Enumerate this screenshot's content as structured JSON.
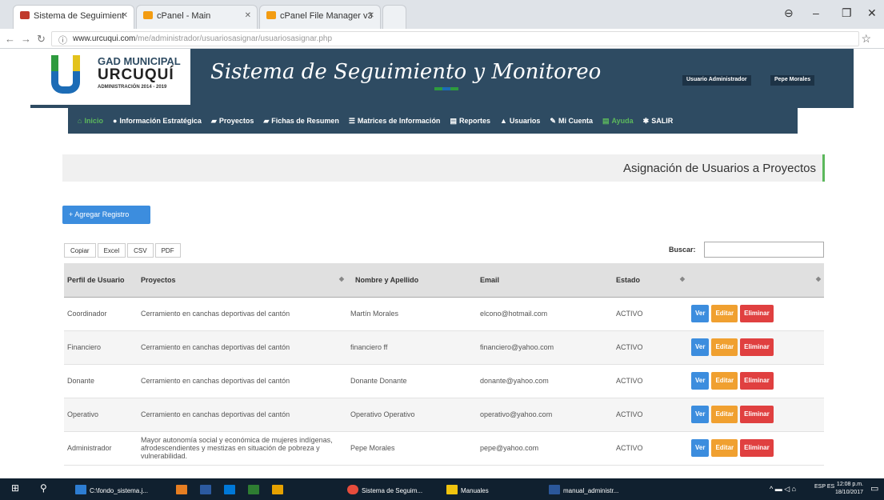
{
  "browser": {
    "tabs": [
      {
        "label": "Sistema de Seguimient",
        "favicon_color": "#c0392b"
      },
      {
        "label": "cPanel - Main",
        "favicon_color": "#f39c12"
      },
      {
        "label": "cPanel File Manager v3",
        "favicon_color": "#f39c12"
      }
    ],
    "url_host": "www.urcuqui.com",
    "url_path": "/me/administrador/usuariosasignar/usuariosasignar.php",
    "back_icon": "back-arrow-icon",
    "forward_icon": "forward-arrow-icon",
    "reload_icon": "reload-icon",
    "star_icon": "bookmark-star-icon"
  },
  "header": {
    "logo_line1": "GAD MUNICIPAL",
    "logo_line2": "URCUQUÍ",
    "logo_line3": "ADMINISTRACIÓN 2014 - 2019",
    "site_title": "Sistema de Seguimiento y Monitoreo",
    "user_role": "Usuario Administrador",
    "user_name": "Pepe Morales"
  },
  "nav": [
    {
      "icon": "home-icon",
      "glyph": "⌂",
      "label": "Inicio"
    },
    {
      "icon": "info-icon",
      "glyph": "●",
      "label": "Información Estratégica"
    },
    {
      "icon": "bookmark-icon",
      "glyph": "▰",
      "label": "Proyectos"
    },
    {
      "icon": "bookmark-icon",
      "glyph": "▰",
      "label": "Fichas de Resumen"
    },
    {
      "icon": "table-icon",
      "glyph": "☰",
      "label": "Matrices de Información"
    },
    {
      "icon": "report-icon",
      "glyph": "▤",
      "label": "Reportes"
    },
    {
      "icon": "user-icon",
      "glyph": "▲",
      "label": "Usuarios"
    },
    {
      "icon": "pencil-icon",
      "glyph": "✎",
      "label": "Mi Cuenta"
    },
    {
      "icon": "help-icon",
      "glyph": "▤",
      "label": "Ayuda"
    },
    {
      "icon": "gear-icon",
      "glyph": "✱",
      "label": "SALIR"
    }
  ],
  "page": {
    "heading": "Asignación de Usuarios a Proyectos",
    "add_button": "+ Agregar Registro",
    "export_buttons": [
      "Copiar",
      "Excel",
      "CSV",
      "PDF"
    ],
    "search_label": "Buscar:",
    "search_value": ""
  },
  "table": {
    "columns": [
      "Perfil de Usuario",
      "Proyectos",
      "Nombre y Apellido",
      "Email",
      "Estado",
      ""
    ],
    "action_labels": {
      "view": "Ver",
      "edit": "Editar",
      "delete": "Eliminar"
    },
    "rows": [
      {
        "perfil": "Coordinador",
        "proyecto": "Cerramiento en canchas deportivas del cantón",
        "nombre": "Martín Morales",
        "email": "elcono@hotmail.com",
        "estado": "ACTIVO"
      },
      {
        "perfil": "Financiero",
        "proyecto": "Cerramiento en canchas deportivas del cantón",
        "nombre": "financiero ff",
        "email": "financiero@yahoo.com",
        "estado": "ACTIVO"
      },
      {
        "perfil": "Donante",
        "proyecto": "Cerramiento en canchas deportivas del cantón",
        "nombre": "Donante Donante",
        "email": "donante@yahoo.com",
        "estado": "ACTIVO"
      },
      {
        "perfil": "Operativo",
        "proyecto": "Cerramiento en canchas deportivas del cantón",
        "nombre": "Operativo Operativo",
        "email": "operativo@yahoo.com",
        "estado": "ACTIVO"
      },
      {
        "perfil": "Administrador",
        "proyecto": "Mayor autonomía social y económica de mujeres indígenas, afrodescendientes y mestizas en situación de pobreza y vulnerabilidad.",
        "nombre": "Pepe Morales",
        "email": "pepe@yahoo.com",
        "estado": "ACTIVO"
      }
    ]
  },
  "taskbar": {
    "items": [
      {
        "label": "C:\\fondo_sistema.j...",
        "color": "#2d7dd2"
      },
      {
        "label": "",
        "color": "#e67e22"
      },
      {
        "label": "",
        "color": "#2c5aa0"
      },
      {
        "label": "",
        "color": "#0078d7"
      },
      {
        "label": "",
        "color": "#2e7d32"
      },
      {
        "label": "",
        "color": "#e6a100"
      },
      {
        "label": "Sistema de Seguim...",
        "color": "#e74c3c"
      },
      {
        "label": "Manuales",
        "color": "#f1c40f"
      },
      {
        "label": "manual_administr...",
        "color": "#2b579a"
      }
    ],
    "lang": "ESP ES",
    "time": "12:08 p.m.",
    "date": "18/10/2017"
  }
}
